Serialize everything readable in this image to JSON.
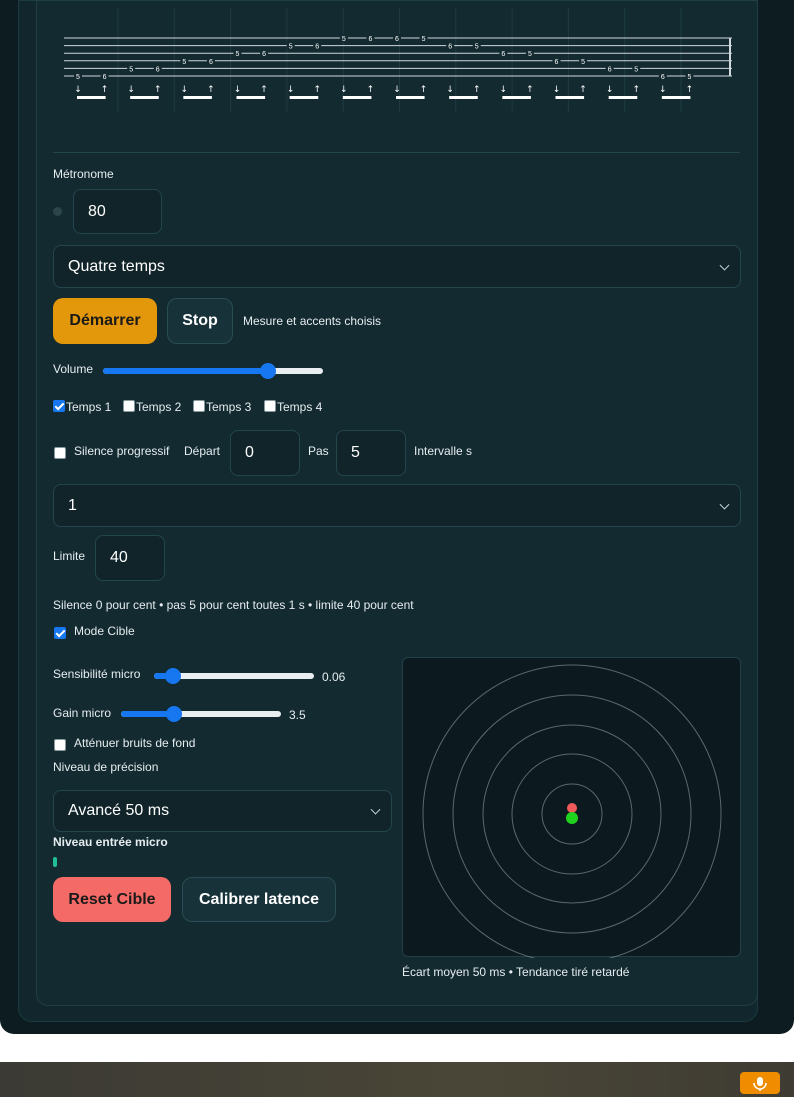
{
  "tab": {
    "strings": 6,
    "notes": [
      {
        "fret": "5",
        "string": 6
      },
      {
        "fret": "6",
        "string": 6
      },
      {
        "fret": "5",
        "string": 5
      },
      {
        "fret": "6",
        "string": 5
      },
      {
        "fret": "5",
        "string": 4
      },
      {
        "fret": "6",
        "string": 4
      },
      {
        "fret": "5",
        "string": 3
      },
      {
        "fret": "6",
        "string": 3
      },
      {
        "fret": "5",
        "string": 2
      },
      {
        "fret": "6",
        "string": 2
      },
      {
        "fret": "5",
        "string": 1
      },
      {
        "fret": "6",
        "string": 1
      },
      {
        "fret": "6",
        "string": 1
      },
      {
        "fret": "5",
        "string": 1
      },
      {
        "fret": "6",
        "string": 2
      },
      {
        "fret": "5",
        "string": 2
      },
      {
        "fret": "6",
        "string": 3
      },
      {
        "fret": "5",
        "string": 3
      },
      {
        "fret": "6",
        "string": 4
      },
      {
        "fret": "5",
        "string": 4
      },
      {
        "fret": "6",
        "string": 5
      },
      {
        "fret": "5",
        "string": 5
      },
      {
        "fret": "6",
        "string": 6
      },
      {
        "fret": "5",
        "string": 6
      }
    ],
    "strokes": [
      "↓",
      "↑"
    ]
  },
  "metronome": {
    "title": "Métronome",
    "bpm": "80",
    "meter_selected": "Quatre temps",
    "start_label": "Démarrer",
    "stop_label": "Stop",
    "status_text": "Mesure et accents choisis",
    "volume_label": "Volume",
    "volume_level": 0.75,
    "beats": [
      {
        "label": "Temps 1",
        "checked": true
      },
      {
        "label": "Temps 2",
        "checked": false
      },
      {
        "label": "Temps 3",
        "checked": false
      },
      {
        "label": "Temps 4",
        "checked": false
      }
    ]
  },
  "silence": {
    "label": "Silence progressif",
    "checked": false,
    "depart_label": "Départ",
    "depart_value": "0",
    "pas_label": "Pas",
    "pas_value": "5",
    "intervalle_label": "Intervalle s",
    "intervalle_selected": "1",
    "limite_label": "Limite",
    "limite_value": "40",
    "summary": "Silence 0 pour cent • pas 5 pour cent toutes 1 s • limite 40 pour cent"
  },
  "cible": {
    "mode_label": "Mode Cible",
    "mode_checked": true,
    "sensibilite_label": "Sensibilité micro",
    "sensibilite_value": "0.06",
    "sensibilite_level": 0.12,
    "gain_label": "Gain micro",
    "gain_value": "3.5",
    "gain_level": 0.33,
    "attenuer_label": "Atténuer bruits de fond",
    "attenuer_checked": false,
    "niveau_precision_label": "Niveau de précision",
    "precision_selected": "Avancé 50 ms",
    "niveau_entree_label": "Niveau entrée micro",
    "reset_label": "Reset Cible",
    "calibrer_label": "Calibrer latence",
    "ecart_text": "Écart moyen 50 ms • Tendance tiré retardé",
    "ring_color": "#9aa9ad",
    "hit_color": "#1ed21e",
    "marker_color": "#f05a5a"
  },
  "colors": {
    "accent": "#1677f0",
    "start_button": "#e3970b",
    "reset_button": "#f46a66",
    "mic_button": "#f08c00"
  }
}
